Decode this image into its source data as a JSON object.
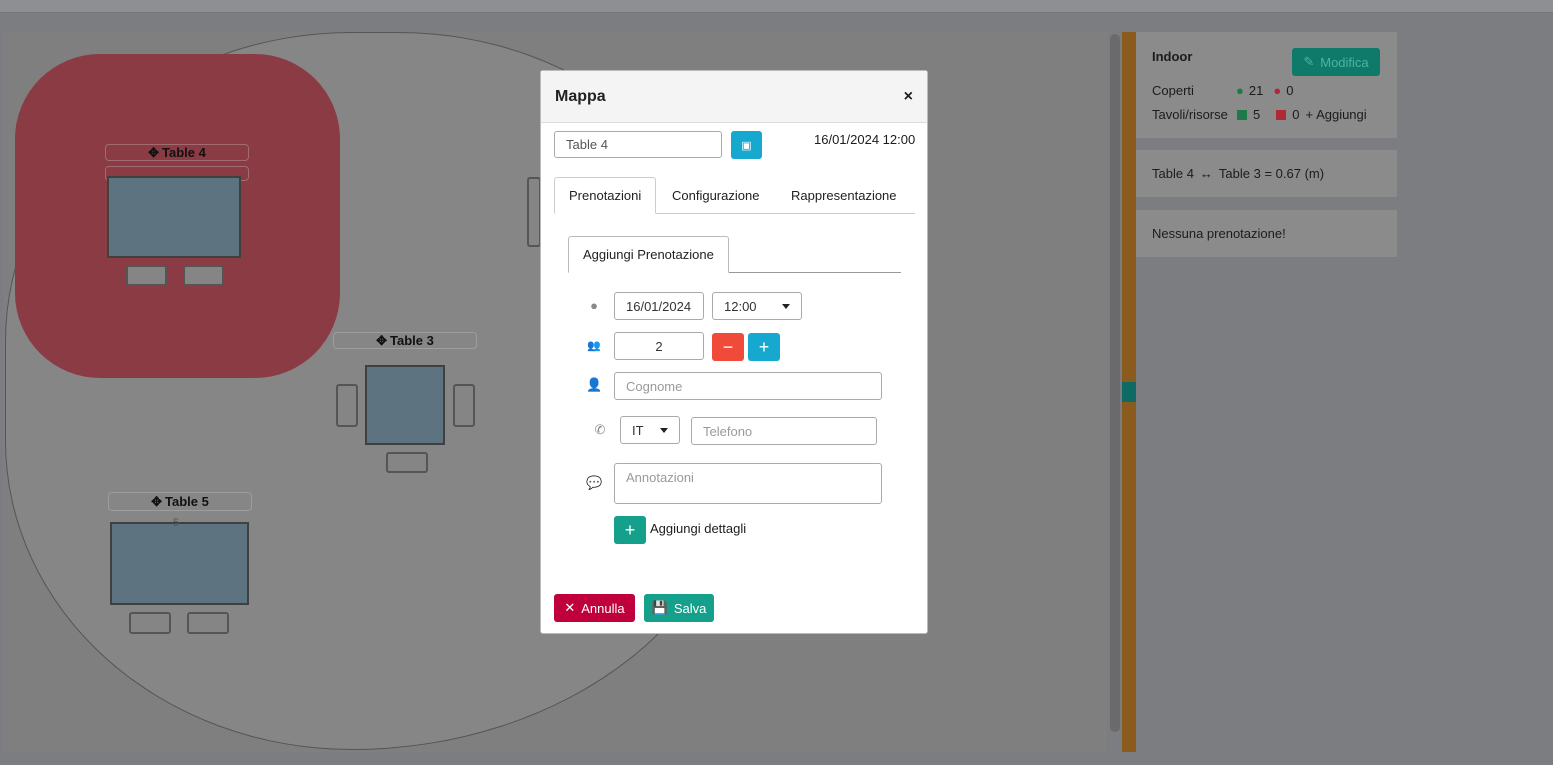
{
  "map": {
    "tables": [
      {
        "name": "Table 4"
      },
      {
        "name": "Table 3"
      },
      {
        "name": "Table 5",
        "count": "5"
      }
    ]
  },
  "side": {
    "area": "Indoor",
    "edit_label": "Modifica",
    "covers_label": "Coperti",
    "covers_free": "21",
    "covers_busy": "0",
    "tables_label": "Tavoli/risorse",
    "tables_free": "5",
    "tables_busy": "0",
    "add_label": "Aggiungi",
    "distance_from": "Table 4",
    "distance_to": "Table 3 = 0.67 (m)",
    "no_bookings": "Nessuna prenotazione!"
  },
  "colors": {
    "green": "#0f7a69",
    "red": "#c0003c",
    "blue": "#17a2c8",
    "orange": "#f04a3a"
  },
  "modal": {
    "title": "Mappa",
    "close": "×",
    "table_name": "Table 4",
    "datetime": "16/01/2024 12:00",
    "tabs": [
      "Prenotazioni",
      "Configurazione",
      "Rappresentazione"
    ],
    "subtab": "Aggiungi Prenotazione",
    "form": {
      "date": "16/01/2024",
      "time": "12:00",
      "guests": "2",
      "minus": "−",
      "plus": "+",
      "surname_ph": "Cognome",
      "country": "IT",
      "phone_ph": "Telefono",
      "notes_ph": "Annotazioni",
      "add_details": "Aggiungi dettagli"
    },
    "cancel": "Annulla",
    "save": "Salva"
  }
}
